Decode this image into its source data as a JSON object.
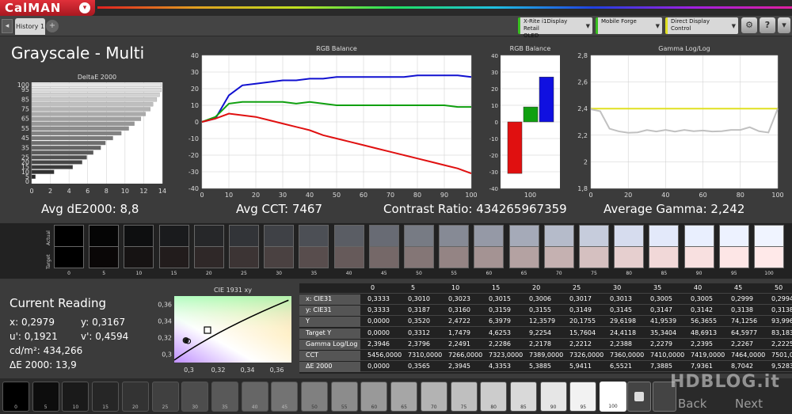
{
  "app": {
    "logo": "CalMAN",
    "caret": "▾"
  },
  "tabs": {
    "history": "History 1",
    "add": "+",
    "left_arrow": "◂"
  },
  "devices": {
    "meter": {
      "line1": "X-Rite i1Display Retail",
      "line2": "OLED"
    },
    "pattern": {
      "line1": "Mobile Forge",
      "line2": ""
    },
    "display": {
      "line1": "Direct Display Control",
      "line2": ""
    }
  },
  "toolbar": {
    "settings": "⚙",
    "help": "?",
    "menu": "▾"
  },
  "page_title": "Grayscale - Multi",
  "stats": {
    "avg_de": "Avg dE2000: 8,8",
    "avg_cct": "Avg CCT: 7467",
    "contrast": "Contrast Ratio: 434265967359",
    "gamma": "Average Gamma: 2,242"
  },
  "chart_data": [
    {
      "type": "bar",
      "title": "DeltaE 2000",
      "orientation": "horizontal",
      "categories": [
        "0",
        "5",
        "10",
        "15",
        "20",
        "25",
        "30",
        "35",
        "40",
        "45",
        "50",
        "55",
        "60",
        "65",
        "70",
        "75",
        "80",
        "85",
        "90",
        "95",
        "100"
      ],
      "values": [
        0,
        0.4,
        2.4,
        4.4,
        5.4,
        5.9,
        6.6,
        7.4,
        7.9,
        8.7,
        9.6,
        10.4,
        11.0,
        11.7,
        12.2,
        12.7,
        13.0,
        13.4,
        13.7,
        13.9,
        13.9
      ],
      "xlim": [
        0,
        14
      ],
      "xticks": [
        "0",
        "2",
        "4",
        "6",
        "8",
        "10",
        "12",
        "14"
      ],
      "yticks": [
        "0",
        "5",
        "10",
        "15",
        "20",
        "25",
        "30",
        "35",
        "40",
        "45",
        "50",
        "55",
        "60",
        "65",
        "70",
        "75",
        "80",
        "85",
        "90",
        "95",
        "100"
      ],
      "ytick_labels": [
        "0",
        "5",
        "10",
        "15",
        "20",
        "25",
        "35",
        "45",
        "55",
        "65",
        "75",
        "85",
        "95",
        "100"
      ]
    },
    {
      "type": "line",
      "title": "RGB Balance",
      "x": [
        0,
        5,
        10,
        15,
        20,
        25,
        30,
        35,
        40,
        45,
        50,
        55,
        60,
        65,
        70,
        75,
        80,
        85,
        90,
        95,
        100
      ],
      "series": [
        {
          "color": "#1010d0",
          "values": [
            0,
            2,
            16,
            22,
            23,
            24,
            25,
            25,
            26,
            26,
            27,
            27,
            27,
            27,
            27,
            27,
            28,
            28,
            28,
            28,
            27
          ]
        },
        {
          "color": "#10a010",
          "values": [
            0,
            3,
            11,
            12,
            12,
            12,
            12,
            11,
            12,
            11,
            10,
            10,
            10,
            10,
            10,
            10,
            10,
            10,
            10,
            9,
            9
          ]
        },
        {
          "color": "#e01010",
          "values": [
            0,
            2,
            5,
            4,
            3,
            1,
            -1,
            -3,
            -5,
            -8,
            -10,
            -12,
            -14,
            -16,
            -18,
            -20,
            -22,
            -24,
            -26,
            -28,
            -31
          ]
        }
      ],
      "xlim": [
        0,
        100
      ],
      "ylim": [
        -40,
        40
      ],
      "xticks": [
        "0",
        "10",
        "20",
        "30",
        "40",
        "50",
        "60",
        "70",
        "80",
        "90",
        "100"
      ],
      "yticks": [
        "40",
        "30",
        "20",
        "10",
        "0",
        "-10",
        "-20",
        "-30",
        "-40"
      ]
    },
    {
      "type": "bar",
      "title": "RGB Balance",
      "categories": [
        "100"
      ],
      "series": [
        {
          "color": "#e01010",
          "values": [
            -31
          ]
        },
        {
          "color": "#10a010",
          "values": [
            9
          ]
        },
        {
          "color": "#1010e0",
          "values": [
            27
          ]
        }
      ],
      "ylim": [
        -40,
        40
      ],
      "yticks": [
        "40",
        "30",
        "20",
        "10",
        "0",
        "-10",
        "-20",
        "-30",
        "-40"
      ]
    },
    {
      "type": "line",
      "title": "Gamma Log/Log",
      "x": [
        0,
        5,
        10,
        15,
        20,
        25,
        30,
        35,
        40,
        45,
        50,
        55,
        60,
        65,
        70,
        75,
        80,
        85,
        90,
        95,
        100
      ],
      "series": [
        {
          "color": "#e0e020",
          "values": [
            2.4,
            2.4,
            2.4,
            2.4,
            2.4,
            2.4,
            2.4,
            2.4,
            2.4,
            2.4,
            2.4,
            2.4,
            2.4,
            2.4,
            2.4,
            2.4,
            2.4,
            2.4,
            2.4,
            2.4,
            2.4
          ]
        },
        {
          "color": "#c0c0c0",
          "values": [
            2.395,
            2.38,
            2.249,
            2.229,
            2.218,
            2.221,
            2.239,
            2.228,
            2.24,
            2.227,
            2.24,
            2.23,
            2.235,
            2.228,
            2.23,
            2.24,
            2.24,
            2.26,
            2.23,
            2.22,
            2.4
          ]
        }
      ],
      "xlim": [
        0,
        100
      ],
      "ylim": [
        1.8,
        2.8
      ],
      "xticks": [
        "0",
        "20",
        "40",
        "60",
        "80",
        "100"
      ],
      "yticks": [
        "2,8",
        "2,6",
        "2,4",
        "2,2",
        "2",
        "1,8"
      ]
    },
    {
      "type": "scatter",
      "title": "CIE 1931 xy",
      "points": [
        {
          "x": 0.2979,
          "y": 0.3167
        },
        {
          "x": 0.3127,
          "y": 0.329
        }
      ],
      "xlim": [
        0.29,
        0.37
      ],
      "ylim": [
        0.29,
        0.37
      ],
      "xticks": [
        "0,3",
        "0,32",
        "0,34",
        "0,36"
      ],
      "yticks": [
        "0,36",
        "0,34",
        "0,32",
        "0,3"
      ]
    }
  ],
  "swatch_strip": {
    "actual_label": "Actual",
    "target_label": "Target",
    "items": [
      {
        "label": "0",
        "actual": "#000000",
        "target": "#000000"
      },
      {
        "label": "5",
        "actual": "#050505",
        "target": "#0a0707"
      },
      {
        "label": "10",
        "actual": "#0e0f10",
        "target": "#161313"
      },
      {
        "label": "15",
        "actual": "#1a1b1d",
        "target": "#221c1c"
      },
      {
        "label": "20",
        "actual": "#262729",
        "target": "#2f2828"
      },
      {
        "label": "25",
        "actual": "#323438",
        "target": "#3c3434"
      },
      {
        "label": "30",
        "actual": "#3f4146",
        "target": "#4a4141"
      },
      {
        "label": "35",
        "actual": "#4c4f55",
        "target": "#584d4d"
      },
      {
        "label": "40",
        "actual": "#5a5d64",
        "target": "#665a5a"
      },
      {
        "label": "45",
        "actual": "#686b74",
        "target": "#756868"
      },
      {
        "label": "50",
        "actual": "#777b84",
        "target": "#847676"
      },
      {
        "label": "55",
        "actual": "#868a95",
        "target": "#948484"
      },
      {
        "label": "60",
        "actual": "#9599a6",
        "target": "#a49393"
      },
      {
        "label": "65",
        "actual": "#a5aab8",
        "target": "#b4a2a2"
      },
      {
        "label": "70",
        "actual": "#b5bbca",
        "target": "#c5b1b1"
      },
      {
        "label": "75",
        "actual": "#c6ccdc",
        "target": "#d5c0c0"
      },
      {
        "label": "80",
        "actual": "#d6dcee",
        "target": "#e6cfcf"
      },
      {
        "label": "85",
        "actual": "#e3e9fa",
        "target": "#f1d8d8"
      },
      {
        "label": "90",
        "actual": "#e9effe",
        "target": "#f8e0e0"
      },
      {
        "label": "95",
        "actual": "#edf2ff",
        "target": "#fde6e6"
      },
      {
        "label": "100",
        "actual": "#f0f4ff",
        "target": "#ffe9e9"
      }
    ]
  },
  "current_reading": {
    "title": "Current Reading",
    "x": "x: 0,2979",
    "y": "y: 0,3167",
    "u": "u': 0,1921",
    "v": "v': 0,4594",
    "cdm2": "cd/m²: 434,266",
    "de": "ΔE 2000: 13,9"
  },
  "table": {
    "columns": [
      "0",
      "5",
      "10",
      "15",
      "20",
      "25",
      "30",
      "35",
      "40",
      "45",
      "50"
    ],
    "rows": [
      {
        "label": "x: CIE31",
        "values": [
          "0,3333",
          "0,3010",
          "0,3023",
          "0,3015",
          "0,3006",
          "0,3017",
          "0,3013",
          "0,3005",
          "0,3005",
          "0,2999",
          "0,2994"
        ]
      },
      {
        "label": "y: CIE31",
        "values": [
          "0,3333",
          "0,3187",
          "0,3160",
          "0,3159",
          "0,3155",
          "0,3149",
          "0,3145",
          "0,3147",
          "0,3142",
          "0,3138",
          "0,3138"
        ]
      },
      {
        "label": "Y",
        "values": [
          "0,0000",
          "0,3520",
          "2,4722",
          "6,3979",
          "12,3579",
          "20,1755",
          "29,6198",
          "41,9539",
          "56,3655",
          "74,1256",
          "93,996"
        ]
      },
      {
        "label": "Target Y",
        "values": [
          "0,0000",
          "0,3312",
          "1,7479",
          "4,6253",
          "9,2254",
          "15,7604",
          "24,4118",
          "35,3404",
          "48,6913",
          "64,5977",
          "83,183"
        ]
      },
      {
        "label": "Gamma Log/Log",
        "values": [
          "2,3946",
          "2,3796",
          "2,2491",
          "2,2286",
          "2,2178",
          "2,2212",
          "2,2388",
          "2,2279",
          "2,2395",
          "2,2267",
          "2,2225"
        ]
      },
      {
        "label": "CCT",
        "values": [
          "5456,0000",
          "7310,0000",
          "7266,0000",
          "7323,0000",
          "7389,0000",
          "7326,0000",
          "7360,0000",
          "7410,0000",
          "7419,0000",
          "7464,0000",
          "7501,0"
        ]
      },
      {
        "label": "ΔE 2000",
        "values": [
          "0,0000",
          "0,3565",
          "2,3945",
          "4,3353",
          "5,3885",
          "5,9411",
          "6,5521",
          "7,3885",
          "7,9361",
          "8,7042",
          "9,5283"
        ]
      }
    ]
  },
  "bottom_swatches": [
    {
      "label": "0",
      "color": "#000000"
    },
    {
      "label": "5",
      "color": "#0d0d0d"
    },
    {
      "label": "10",
      "color": "#1a1a1a"
    },
    {
      "label": "15",
      "color": "#262626"
    },
    {
      "label": "20",
      "color": "#333333"
    },
    {
      "label": "25",
      "color": "#404040"
    },
    {
      "label": "30",
      "color": "#4d4d4d"
    },
    {
      "label": "35",
      "color": "#595959"
    },
    {
      "label": "40",
      "color": "#666666"
    },
    {
      "label": "45",
      "color": "#737373"
    },
    {
      "label": "50",
      "color": "#808080"
    },
    {
      "label": "55",
      "color": "#8c8c8c"
    },
    {
      "label": "60",
      "color": "#999999"
    },
    {
      "label": "65",
      "color": "#a6a6a6"
    },
    {
      "label": "70",
      "color": "#b3b3b3"
    },
    {
      "label": "75",
      "color": "#bfbfbf"
    },
    {
      "label": "80",
      "color": "#cccccc"
    },
    {
      "label": "85",
      "color": "#d9d9d9"
    },
    {
      "label": "90",
      "color": "#e6e6e6"
    },
    {
      "label": "95",
      "color": "#f2f2f2"
    },
    {
      "label": "100",
      "color": "#ffffff"
    }
  ],
  "watermark": {
    "brand": "HDBLOG.it",
    "back": "Back",
    "next": "Next"
  }
}
